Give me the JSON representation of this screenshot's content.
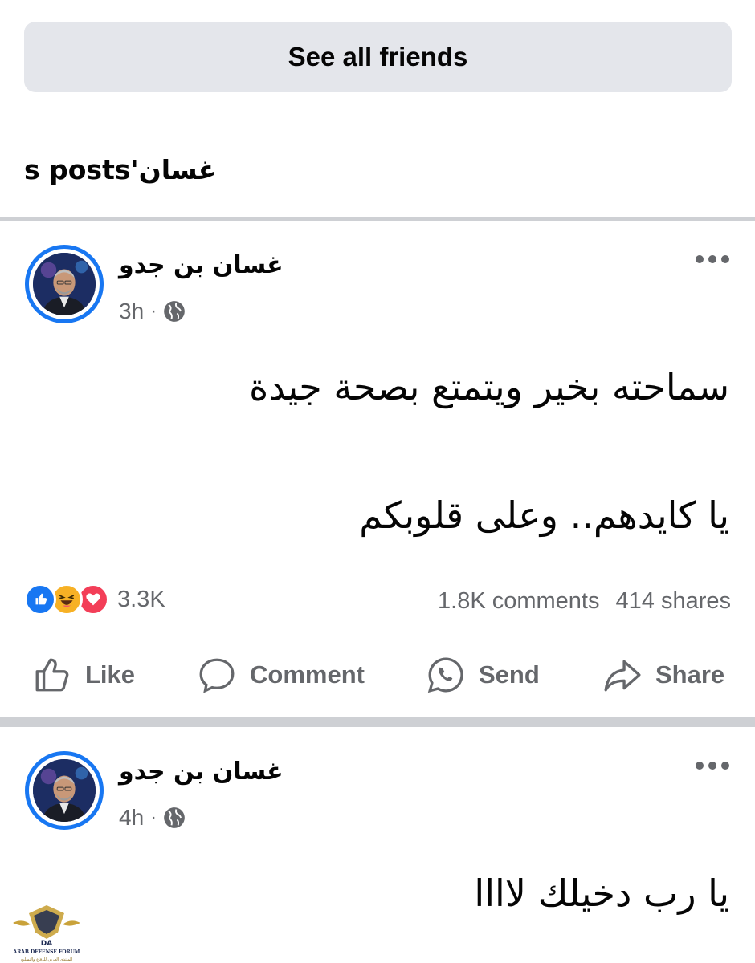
{
  "friends": {
    "see_all_label": "See all friends"
  },
  "section": {
    "title": "غسان's posts"
  },
  "posts": [
    {
      "author": "غسان بن جدو",
      "time": "3h",
      "privacy_icon": "globe-icon",
      "lines": [
        "سماحته بخير ويتمتع بصحة جيدة",
        "يا كايدهم.. وعلى قلوبكم"
      ],
      "reactions": {
        "icons": [
          "like-icon",
          "haha-icon",
          "love-icon"
        ],
        "count": "3.3K"
      },
      "comments": "1.8K comments",
      "shares": "414 shares",
      "actions": {
        "like": "Like",
        "comment": "Comment",
        "send": "Send",
        "share": "Share"
      }
    },
    {
      "author": "غسان بن جدو",
      "time": "4h",
      "privacy_icon": "globe-icon",
      "lines": [
        "يا رب دخيلك لاااا"
      ]
    }
  ],
  "colors": {
    "accent": "#1877f2",
    "secondary_text": "#65676b",
    "button_bg": "#e4e6eb",
    "divider": "#ced0d4"
  },
  "watermark": {
    "name": "ARAB DEFENSE FORUM",
    "arabic": "المنتدى العربي للدفاع والتسليح",
    "initials": "DA"
  }
}
